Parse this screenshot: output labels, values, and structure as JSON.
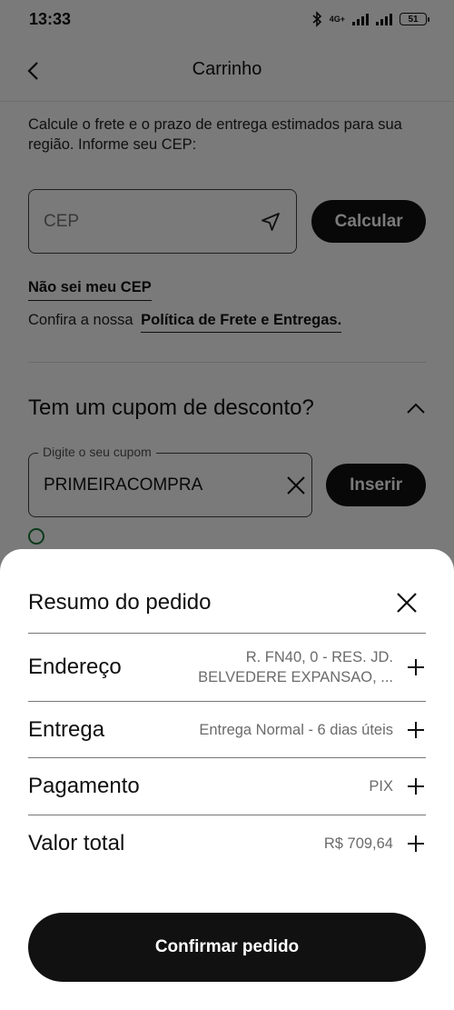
{
  "status_bar": {
    "time": "13:33",
    "network": "4G+",
    "battery": "51"
  },
  "header": {
    "title": "Carrinho"
  },
  "freight": {
    "description": "Calcule o frete e o prazo de entrega estimados para sua região. Informe seu CEP:",
    "cep_placeholder": "CEP",
    "calculate_label": "Calcular",
    "unknown_cep_link": "Não sei meu CEP",
    "policy_prefix": "Confira a nossa",
    "policy_link": "Política de Frete e Entregas."
  },
  "coupon": {
    "heading": "Tem um cupom de desconto?",
    "field_label": "Digite o seu cupom",
    "field_value": "PRIMEIRACOMPRA",
    "insert_label": "Inserir"
  },
  "summary": {
    "title": "Resumo do pedido",
    "rows": [
      {
        "label": "Endereço",
        "value_line1": "R. FN40, 0 - RES. JD.",
        "value_line2": "BELVEDERE EXPANSAO, ..."
      },
      {
        "label": "Entrega",
        "value": "Entrega Normal - 6 dias úteis"
      },
      {
        "label": "Pagamento",
        "value": "PIX"
      },
      {
        "label": "Valor total",
        "value": "R$ 709,64"
      }
    ],
    "confirm_label": "Confirmar pedido"
  },
  "colors": {
    "primary": "#111111",
    "overlay": "rgba(0,0,0,0.52)",
    "muted_text": "#6b6b6b"
  }
}
